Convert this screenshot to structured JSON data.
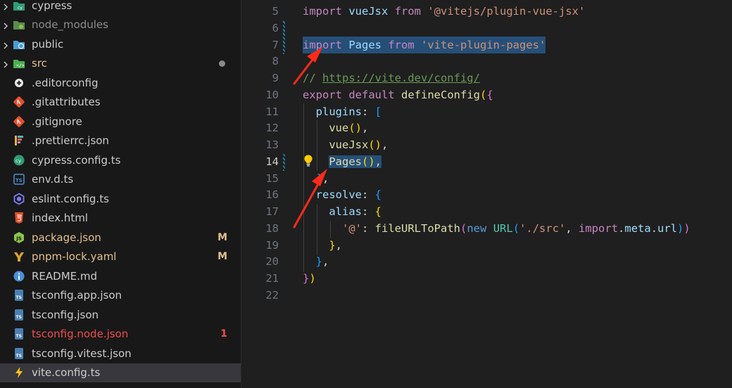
{
  "explorer": {
    "items": [
      {
        "name": "cypress",
        "kind": "folder",
        "icon": "cypress-folder-icon",
        "color": "#cccccc"
      },
      {
        "name": "node_modules",
        "kind": "folder",
        "icon": "node-folder-icon",
        "color": "#8c8c8c"
      },
      {
        "name": "public",
        "kind": "folder",
        "icon": "public-folder-icon",
        "color": "#cccccc"
      },
      {
        "name": "src",
        "kind": "folder",
        "icon": "src-folder-icon",
        "color": "#e2c08d",
        "status": "dot"
      },
      {
        "name": ".editorconfig",
        "kind": "file",
        "icon": "editorconfig-icon",
        "color": "#cccccc"
      },
      {
        "name": ".gitattributes",
        "kind": "file",
        "icon": "git-icon",
        "color": "#cccccc"
      },
      {
        "name": ".gitignore",
        "kind": "file",
        "icon": "git-icon",
        "color": "#cccccc"
      },
      {
        "name": ".prettierrc.json",
        "kind": "file",
        "icon": "prettier-icon",
        "color": "#cccccc"
      },
      {
        "name": "cypress.config.ts",
        "kind": "file",
        "icon": "cypress-icon",
        "color": "#cccccc"
      },
      {
        "name": "env.d.ts",
        "kind": "file",
        "icon": "typescript-def-icon",
        "color": "#cccccc"
      },
      {
        "name": "eslint.config.ts",
        "kind": "file",
        "icon": "eslint-icon",
        "color": "#cccccc"
      },
      {
        "name": "index.html",
        "kind": "file",
        "icon": "html-icon",
        "color": "#cccccc"
      },
      {
        "name": "package.json",
        "kind": "file",
        "icon": "nodejs-icon",
        "color": "#e2c08d",
        "badge": "M",
        "badge_color": "#e2c08d"
      },
      {
        "name": "pnpm-lock.yaml",
        "kind": "file",
        "icon": "yaml-icon",
        "color": "#e2c08d",
        "badge": "M",
        "badge_color": "#e2c08d"
      },
      {
        "name": "README.md",
        "kind": "file",
        "icon": "info-icon",
        "color": "#cccccc"
      },
      {
        "name": "tsconfig.app.json",
        "kind": "file",
        "icon": "tsconfig-icon",
        "color": "#cccccc"
      },
      {
        "name": "tsconfig.json",
        "kind": "file",
        "icon": "tsconfig-icon",
        "color": "#cccccc"
      },
      {
        "name": "tsconfig.node.json",
        "kind": "file",
        "icon": "tsconfig-icon",
        "color": "#f14c4c",
        "badge": "1",
        "badge_color": "#f14c4c"
      },
      {
        "name": "tsconfig.vitest.json",
        "kind": "file",
        "icon": "tsconfig-icon",
        "color": "#cccccc"
      },
      {
        "name": "vite.config.ts",
        "kind": "file",
        "icon": "vite-icon",
        "color": "#cccccc",
        "selected": true
      }
    ]
  },
  "editor": {
    "active_line": "14",
    "lines": [
      {
        "n": "5",
        "tokens": [
          [
            "kw",
            "import"
          ],
          [
            "punc",
            " "
          ],
          [
            "var",
            "vueJsx"
          ],
          [
            "punc",
            " "
          ],
          [
            "kw",
            "from"
          ],
          [
            "punc",
            " "
          ],
          [
            "str",
            "'@vitejs/plugin-vue-jsx'"
          ]
        ]
      },
      {
        "n": "6",
        "tokens": []
      },
      {
        "n": "7",
        "tokens": [
          [
            "kw",
            "import"
          ],
          [
            "punc",
            " "
          ],
          [
            "var",
            "Pages"
          ],
          [
            "punc",
            " "
          ],
          [
            "kw",
            "from"
          ],
          [
            "punc",
            " "
          ],
          [
            "str",
            "'vite-plugin-pages'"
          ]
        ],
        "highlight": true
      },
      {
        "n": "8",
        "tokens": []
      },
      {
        "n": "9",
        "tokens": [
          [
            "cmt",
            "// "
          ],
          [
            "link",
            "https://vite.dev/config/"
          ]
        ]
      },
      {
        "n": "10",
        "tokens": [
          [
            "kw",
            "export"
          ],
          [
            "punc",
            " "
          ],
          [
            "kw",
            "default"
          ],
          [
            "punc",
            " "
          ],
          [
            "fn",
            "defineConfig"
          ],
          [
            "b1",
            "("
          ],
          [
            "b2",
            "{"
          ]
        ]
      },
      {
        "n": "11",
        "tokens": [
          [
            "punc",
            "  "
          ],
          [
            "var",
            "plugins"
          ],
          [
            "punc",
            ": "
          ],
          [
            "b3",
            "["
          ]
        ]
      },
      {
        "n": "12",
        "tokens": [
          [
            "punc",
            "    "
          ],
          [
            "fn",
            "vue"
          ],
          [
            "b1",
            "()"
          ],
          [
            "punc",
            ","
          ]
        ]
      },
      {
        "n": "13",
        "tokens": [
          [
            "punc",
            "    "
          ],
          [
            "fn",
            "vueJsx"
          ],
          [
            "b1",
            "()"
          ],
          [
            "punc",
            ","
          ]
        ]
      },
      {
        "n": "14",
        "tokens": [
          [
            "punc",
            "    "
          ],
          [
            "fn",
            "Pages"
          ],
          [
            "b1",
            "()"
          ],
          [
            "punc",
            ","
          ]
        ],
        "highlight_from": 1
      },
      {
        "n": "15",
        "tokens": [
          [
            "punc",
            "  "
          ],
          [
            "b3",
            "]"
          ],
          [
            "punc",
            ","
          ]
        ]
      },
      {
        "n": "16",
        "tokens": [
          [
            "punc",
            "  "
          ],
          [
            "var",
            "resolve"
          ],
          [
            "punc",
            ": "
          ],
          [
            "b3",
            "{"
          ]
        ]
      },
      {
        "n": "17",
        "tokens": [
          [
            "punc",
            "    "
          ],
          [
            "var",
            "alias"
          ],
          [
            "punc",
            ": "
          ],
          [
            "b1",
            "{"
          ]
        ]
      },
      {
        "n": "18",
        "tokens": [
          [
            "punc",
            "      "
          ],
          [
            "str",
            "'@'"
          ],
          [
            "punc",
            ": "
          ],
          [
            "fn",
            "fileURLToPath"
          ],
          [
            "b2",
            "("
          ],
          [
            "kw2",
            "new"
          ],
          [
            "punc",
            " "
          ],
          [
            "cls",
            "URL"
          ],
          [
            "b3",
            "("
          ],
          [
            "str",
            "'./src'"
          ],
          [
            "punc",
            ", "
          ],
          [
            "kw",
            "import"
          ],
          [
            "punc",
            "."
          ],
          [
            "var",
            "meta"
          ],
          [
            "punc",
            "."
          ],
          [
            "var",
            "url"
          ],
          [
            "b3",
            ")"
          ],
          [
            "b2",
            ")"
          ]
        ]
      },
      {
        "n": "19",
        "tokens": [
          [
            "punc",
            "    "
          ],
          [
            "b1",
            "}"
          ],
          [
            "punc",
            ","
          ]
        ]
      },
      {
        "n": "20",
        "tokens": [
          [
            "punc",
            "  "
          ],
          [
            "b3",
            "}"
          ],
          [
            "punc",
            ","
          ]
        ]
      },
      {
        "n": "21",
        "tokens": [
          [
            "b2",
            "}"
          ],
          [
            "b1",
            ")"
          ]
        ]
      },
      {
        "n": "22",
        "tokens": []
      }
    ]
  },
  "annotations": {
    "arrow_color": "#ff2a1a"
  }
}
